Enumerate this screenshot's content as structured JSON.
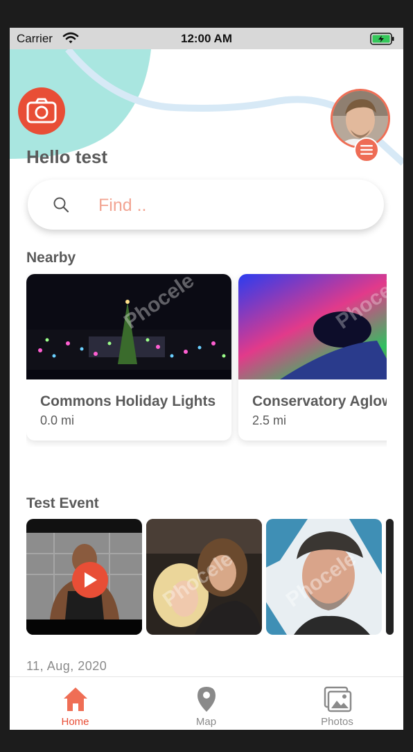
{
  "status_bar": {
    "carrier": "Carrier",
    "time": "12:00 AM"
  },
  "header": {
    "greeting": "Hello test"
  },
  "search": {
    "placeholder": "Find .."
  },
  "nearby": {
    "title": "Nearby",
    "places": [
      {
        "name": "Commons Holiday Lights",
        "distance": "0.0 mi"
      },
      {
        "name": "Conservatory Aglow",
        "distance": "2.5 mi"
      }
    ]
  },
  "event": {
    "title": "Test Event",
    "date": "11, Aug, 2020",
    "watermark": "Phocele"
  },
  "tabs": [
    {
      "label": "Home",
      "icon": "home-icon"
    },
    {
      "label": "Map",
      "icon": "map-pin-icon"
    },
    {
      "label": "Photos",
      "icon": "photos-icon"
    }
  ],
  "colors": {
    "accent": "#e84e36",
    "mint": "#a9e6e0",
    "text": "#5a5a5a",
    "placeholder": "#f2a593",
    "tab_inactive": "#8a8a8a"
  }
}
